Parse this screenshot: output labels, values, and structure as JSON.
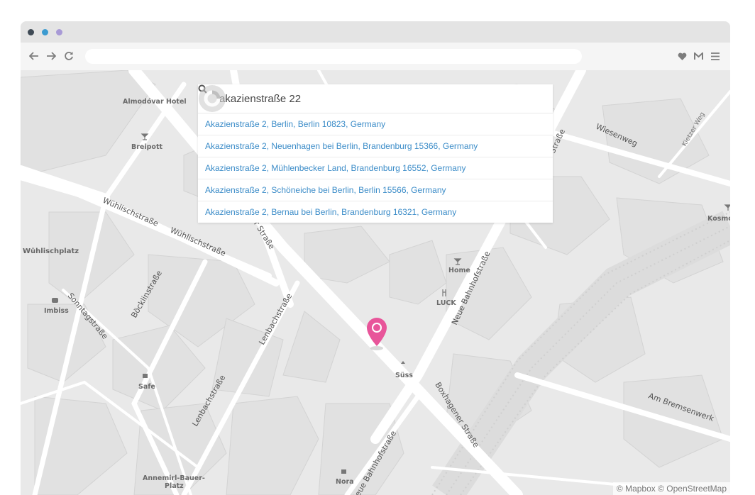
{
  "window": {
    "dots": [
      {
        "name": "close",
        "color": "#3f4a55"
      },
      {
        "name": "minimize",
        "color": "#3c9bd0"
      },
      {
        "name": "maximize",
        "color": "#a89ad6"
      }
    ]
  },
  "toolbar": {
    "back_icon": "back-arrow-icon",
    "forward_icon": "forward-arrow-icon",
    "reload_icon": "reload-icon",
    "heart_icon": "heart-icon",
    "gmail_icon": "gmail-icon",
    "menu_icon": "hamburger-menu-icon",
    "url": ""
  },
  "geocoder": {
    "query": "akazienstraße 22",
    "results": [
      "Akazienstraße 2, Berlin, Berlin 10823, Germany",
      "Akazienstraße 2, Neuenhagen bei Berlin, Brandenburg 15366, Germany",
      "Akazienstraße 2, Mühlenbecker Land, Brandenburg 16552, Germany",
      "Akazienstraße 2, Schöneiche bei Berlin, Berlin 15566, Germany",
      "Akazienstraße 2, Bernau bei Berlin, Brandenburg 16321, Germany"
    ],
    "link_color": "#3b8cc8"
  },
  "map": {
    "streets": {
      "wuehlisch1": "Wühlischstraße",
      "wuehlisch2": "Wühlischstraße",
      "wuehlischplatz": "Wühlischplatz",
      "sonntag": "Sonntagstraße",
      "boecklin": "Böcklinstraße",
      "lenbach1": "Lenbachstraße",
      "lenbach2": "Lenbachstraße",
      "neue_bahnhof1": "Neue Bahnhofstraße",
      "neue_bahnhof2": "Neue Bahnhofstraße",
      "boxhagener": "Boxhagener Straße",
      "wiesenweg": "Wiesenweg",
      "am_bremsenwerk": "Am Bremsenwerk",
      "kietzer_weg": "Kietzer Weg",
      "strasse_top": "Straße",
      "strasse_mid": "er Straße"
    },
    "pois": {
      "almodovar": "Almodóvar Hotel",
      "breipott": "Breipott",
      "home": "Home",
      "luck": "LUCK",
      "imbiss": "Imbiss",
      "safe": "Safe",
      "suess": "Süss",
      "nora": "Nora",
      "annemirl_line1": "Annemirl-Bauer-",
      "annemirl_line2": "Platz",
      "kosmos": "Kosmo"
    },
    "marker_color": "#e8559a",
    "attribution": {
      "mapbox": "© Mapbox",
      "osm": "© OpenStreetMap"
    }
  }
}
